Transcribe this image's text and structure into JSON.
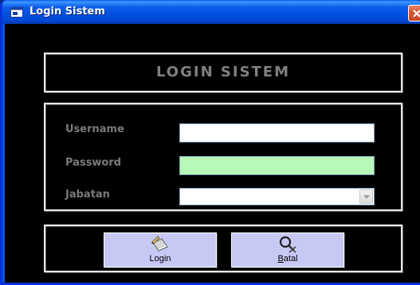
{
  "window": {
    "title": "Login Sistem"
  },
  "header": {
    "heading": "LOGIN SISTEM"
  },
  "form": {
    "username_label": "Username",
    "username_value": "",
    "password_label": "Password",
    "password_value": "",
    "jabatan_label": "Jabatan",
    "jabatan_value": ""
  },
  "buttons": {
    "login_label": "Login",
    "batal_label": "Batal",
    "batal_mnemonic": "B",
    "batal_rest": "atal"
  },
  "colors": {
    "password_field_bg": "#b7f7b7",
    "button_bg": "#c8c8f5",
    "client_bg": "#000000"
  },
  "icons": {
    "title": "form-icon",
    "close": "close-icon",
    "login": "notepad-pencil-icon",
    "batal": "magnifier-cancel-icon"
  }
}
